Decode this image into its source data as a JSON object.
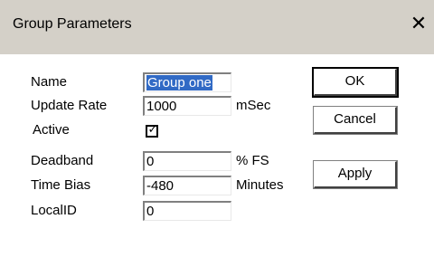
{
  "window": {
    "title": "Group Parameters",
    "close_glyph": "✕"
  },
  "fields": {
    "name": {
      "label": "Name",
      "value": "Group one"
    },
    "update_rate": {
      "label": "Update Rate",
      "value": "1000",
      "unit": "mSec"
    },
    "active": {
      "label": "Active",
      "checked": true,
      "mark": "✓"
    },
    "deadband": {
      "label": "Deadband",
      "value": "0",
      "unit": "% FS"
    },
    "time_bias": {
      "label": "Time Bias",
      "value": "-480",
      "unit": "Minutes"
    },
    "local_id": {
      "label": "LocalID",
      "value": "0"
    }
  },
  "buttons": {
    "ok": "OK",
    "cancel": "Cancel",
    "apply": "Apply"
  },
  "colors": {
    "titlebar": "#d4d0c8",
    "selection": "#316ac5"
  }
}
